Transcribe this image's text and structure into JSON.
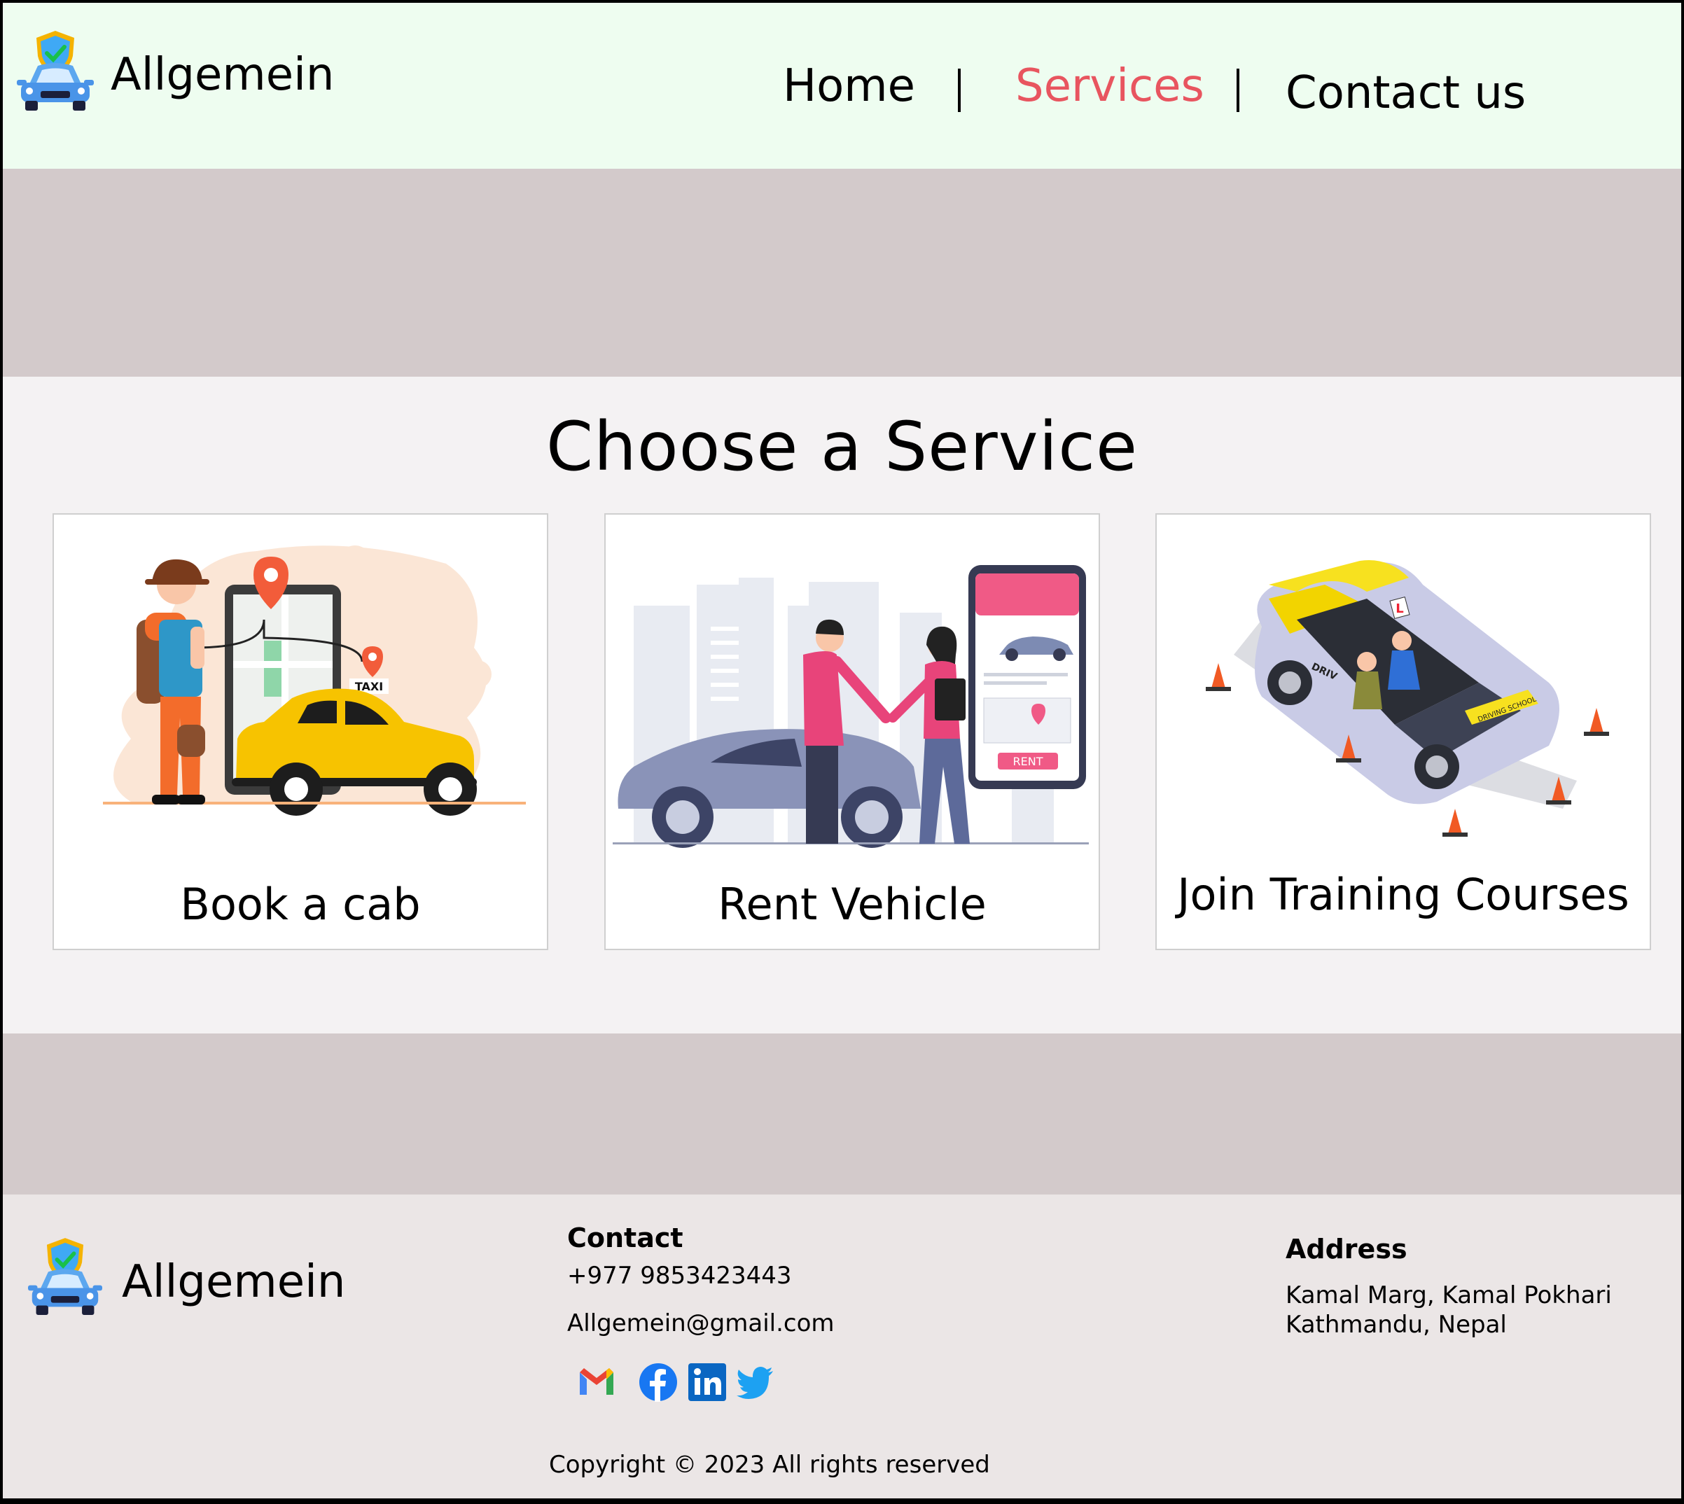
{
  "header": {
    "brand": "Allgemein",
    "nav": [
      {
        "label": "Home",
        "color": "#000000"
      },
      {
        "label": "Services",
        "color": "#e8555f"
      },
      {
        "label": "Contact us",
        "color": "#000000"
      }
    ]
  },
  "main": {
    "title": "Choose a Service",
    "cards": [
      {
        "label": "Book a cab",
        "taxi_sign": "TAXI"
      },
      {
        "label": "Rent Vehicle",
        "rent_button": "RENT"
      },
      {
        "label": "Join Training Courses",
        "car_sign": "L",
        "side_text": "DRIV",
        "hood_text": "DRIVING SCHOOL"
      }
    ]
  },
  "footer": {
    "brand": "Allgemein",
    "contact": {
      "heading": "Contact",
      "phone": "+977 9853423443",
      "email": "Allgemein@gmail.com"
    },
    "address": {
      "heading": "Address",
      "line1": "Kamal Marg, Kamal Pokhari",
      "line2": "Kathmandu, Nepal"
    },
    "social_icons": [
      "gmail-icon",
      "facebook-icon",
      "linkedin-icon",
      "twitter-icon"
    ],
    "copyright": "Copyright © 2023 All rights reserved"
  },
  "colors": {
    "header_bg": "#eefdf0",
    "band_bg": "#d3cacb",
    "accent": "#e8555f",
    "footer_bg": "#ebe6e6"
  }
}
